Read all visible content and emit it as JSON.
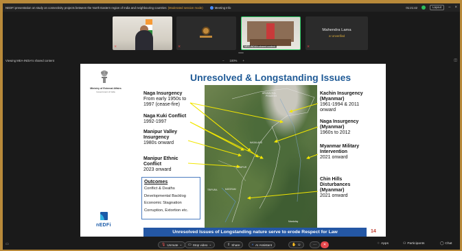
{
  "titlebar": {
    "title": "NEDFi presentation on study on connectivity projects between the North Eastern region of India and neighbouring countries",
    "recording": "(Moderated session mode)",
    "meeting_info": "Meeting Info",
    "time": "01:21:42",
    "layout": "Layout"
  },
  "tiles": [
    {
      "label": ""
    },
    {
      "label": ""
    },
    {
      "label": "MEA-INDIA's shared content"
    },
    {
      "name": "Mahendra Lama",
      "status": "Unverified"
    }
  ],
  "share_header": {
    "viewing": "Viewing MEA-INDIA's shared content",
    "zoom_out": "−",
    "zoom_level": "100%",
    "zoom_in": "+"
  },
  "slide": {
    "title": "Unresolved & Longstanding Issues",
    "ministry": "Ministry of External Affairs",
    "gov": "Government of India",
    "logo_text": "nEDFi",
    "left_labels": [
      {
        "bold": "Naga Insurgency",
        "lines": [
          "From early 1950s to",
          "1997 (cease-fire)"
        ]
      },
      {
        "bold": "Naga Kuki Conflict",
        "lines": [
          "1992-1997"
        ]
      },
      {
        "bold": "Manipur Valley",
        "lines": [
          "Insurgency",
          "1980s onward"
        ]
      },
      {
        "bold": "Manipur Ethnic",
        "lines": [
          "Conflict",
          "2023 onward"
        ]
      }
    ],
    "right_labels": [
      {
        "bold": "Kachin Insurgency",
        "lines": [
          "(Myanmar)",
          "1961-1994 & 2011",
          "onward"
        ]
      },
      {
        "bold": "Naga Insurgency",
        "lines": [
          "(Myanmar)",
          "1960s to 2012"
        ]
      },
      {
        "bold": "Myanmar Military",
        "lines": [
          "Intervention",
          "2021 onward"
        ]
      },
      {
        "bold": "Chin Hills",
        "lines": [
          "Disturbances",
          "(Myanmar)",
          "2021 onward"
        ]
      }
    ],
    "outcomes": {
      "heading": "Outcomes",
      "items": [
        "Conflict & Deaths",
        "Developmental Backlog",
        "Economic Stagnation",
        "Corruption, Extortion etc."
      ]
    },
    "map_labels": [
      "ARUNACHAL",
      "PRADESH",
      "NAGALAND",
      "MANIPUR",
      "MIZORAM",
      "TRIPURA",
      "Mandalay"
    ],
    "banner": "Unresolved Issues of Longstanding nature serve to erode Respect for Law",
    "page": "14"
  },
  "toolbar": {
    "unmute": "Unmute",
    "stop_video": "Stop video",
    "share": "Share",
    "ai_assistant": "AI Assistant",
    "apps": "Apps",
    "participants": "Participants",
    "chat": "Chat"
  },
  "colors": {
    "title_blue": "#1f5a96",
    "banner_blue": "#2457a4",
    "arrow_yellow": "#f2e600",
    "active_speaker": "#2fd068",
    "end_red": "#e5484d"
  }
}
